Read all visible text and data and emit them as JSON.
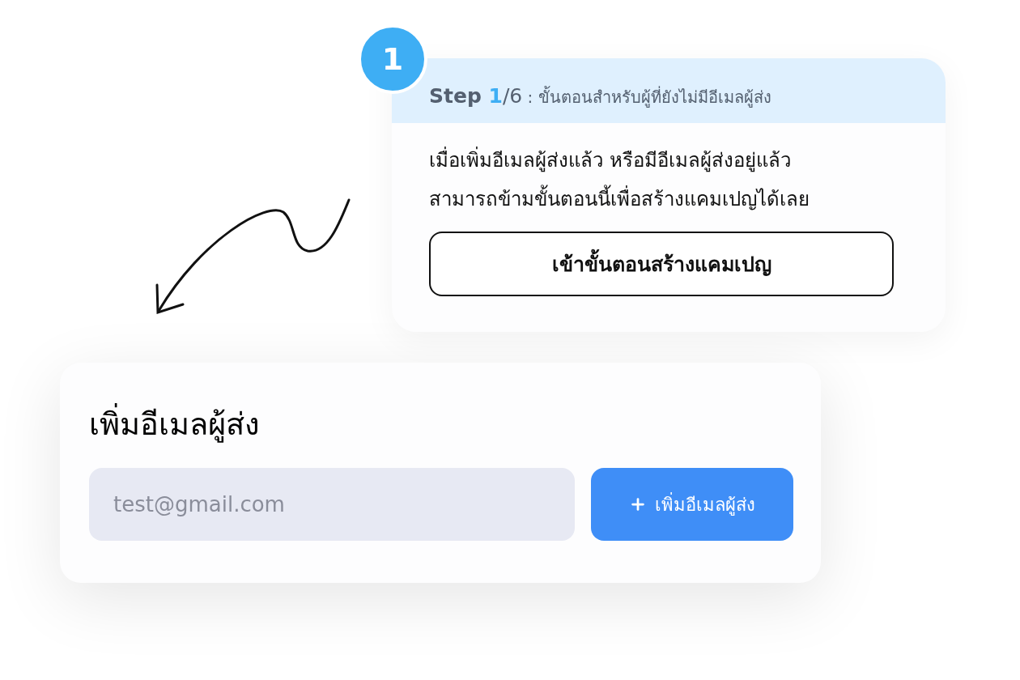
{
  "step_card": {
    "badge": "1",
    "label": "Step ",
    "current": "1",
    "total": "/6",
    "description": " : ขั้นตอนสำหรับผู้ที่ยังไม่มีอีเมลผู้ส่ง",
    "body_lines": [
      "เมื่อเพิ่มอีเมลผู้ส่งแล้ว หรือมีอีเมลผู้ส่งอยู่แล้ว",
      "สามารถข้ามขั้นตอนนี้เพื่อสร้างแคมเปญได้เลย"
    ],
    "button": "เข้าขั้นตอนสร้างแคมเปญ"
  },
  "sender_card": {
    "title": "เพิ่มอีเมลผู้ส่ง",
    "email_field": {
      "placeholder": "test@gmail.com"
    },
    "add_button": "เพิ่มอีเมลผู้ส่ง"
  }
}
